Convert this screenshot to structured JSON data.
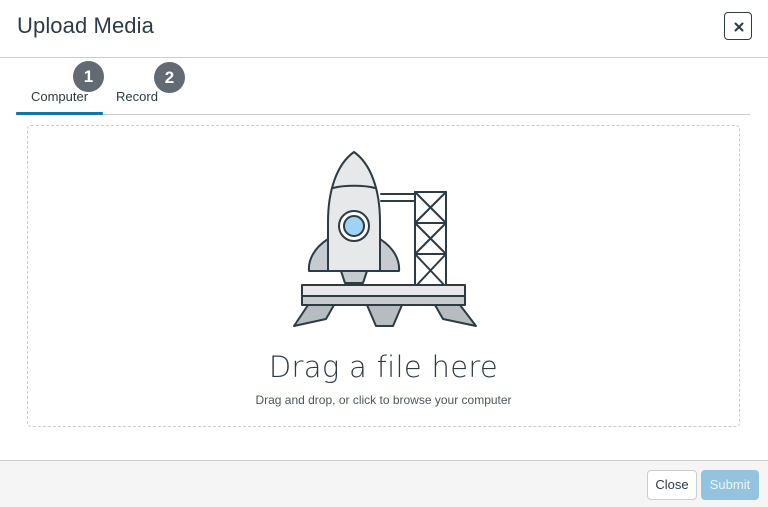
{
  "modal": {
    "title": "Upload Media",
    "close_icon": "close-x-icon"
  },
  "tabs": [
    {
      "label": "Computer",
      "selected": true
    },
    {
      "label": "Record",
      "selected": false
    }
  ],
  "step_badges": [
    "1",
    "2"
  ],
  "dropzone": {
    "illustration": "rocket-launchpad-icon",
    "title": "Drag a file here",
    "hint": "Drag and drop, or click to browse your computer"
  },
  "footer": {
    "close_label": "Close",
    "submit_label": "Submit",
    "submit_disabled": true
  },
  "colors": {
    "accent": "#0e76a8",
    "text": "#2d3b45",
    "badge": "#626a73",
    "submit_disabled_bg": "#93c3de",
    "rocket_window": "#9fd2f3"
  }
}
